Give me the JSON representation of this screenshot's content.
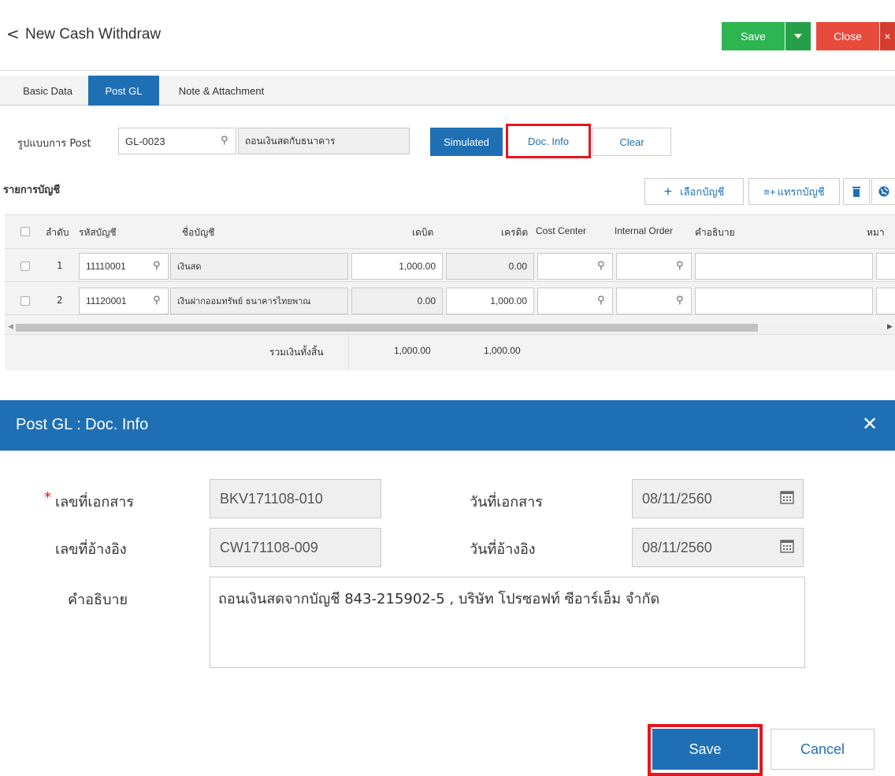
{
  "header": {
    "back_glyph": "<",
    "title": "New Cash Withdraw",
    "save_label": "Save",
    "close_label": "Close",
    "close_x": "×"
  },
  "tabs": [
    {
      "label": "Basic Data"
    },
    {
      "label": "Post GL"
    },
    {
      "label": "Note & Attachment"
    }
  ],
  "post_form": {
    "format_label": "รูปแบบการ Post",
    "format_code": "GL-0023",
    "format_name": "ถอนเงินสดกับธนาคาร",
    "simulated_label": "Simulated",
    "docinfo_label": "Doc. Info",
    "clear_label": "Clear"
  },
  "accounts": {
    "section_title": "รายการบัญชี",
    "select_label": "เลือกบัญชี",
    "insert_label": "แทรกบัญชี",
    "columns": {
      "seq": "ลำดับ",
      "code": "รหัสบัญชี",
      "name": "ชื่อบัญชี",
      "debit": "เดบิต",
      "credit": "เครดิต",
      "cost_center": "Cost Center",
      "internal_order": "Internal Order",
      "description": "คำอธิบาย",
      "note": "หมา"
    },
    "rows": [
      {
        "seq": "1",
        "code": "11110001",
        "name": "เงินสด",
        "debit": "1,000.00",
        "credit": "0.00"
      },
      {
        "seq": "2",
        "code": "11120001",
        "name": "เงินฝากออมทรัพย์ ธนาคารไทยพาณ",
        "debit": "0.00",
        "credit": "1,000.00"
      }
    ],
    "total_label": "รวมเงินทั้งสิ้น",
    "total_debit": "1,000.00",
    "total_credit": "1,000.00"
  },
  "modal": {
    "title": "Post GL : Doc. Info",
    "close_glyph": "✕",
    "required_mark": "*",
    "doc_no_label": "เลขที่เอกสาร",
    "doc_no_value": "BKV171108-010",
    "doc_date_label": "วันที่เอกสาร",
    "doc_date_value": "08/11/2560",
    "ref_no_label": "เลขที่อ้างอิง",
    "ref_no_value": "CW171108-009",
    "ref_date_label": "วันที่อ้างอิง",
    "ref_date_value": "08/11/2560",
    "desc_label": "คำอธิบาย",
    "desc_value": "ถอนเงินสดจากบัญชี 843-215902-5 , บริษัท โปรซอฟท์ ซีอาร์เอ็ม จำกัด",
    "save_label": "Save",
    "cancel_label": "Cancel"
  },
  "colors": {
    "primary": "#1f6fb5",
    "save_green": "#2db552",
    "close_red": "#e84a3c",
    "highlight": "#e8141c"
  }
}
